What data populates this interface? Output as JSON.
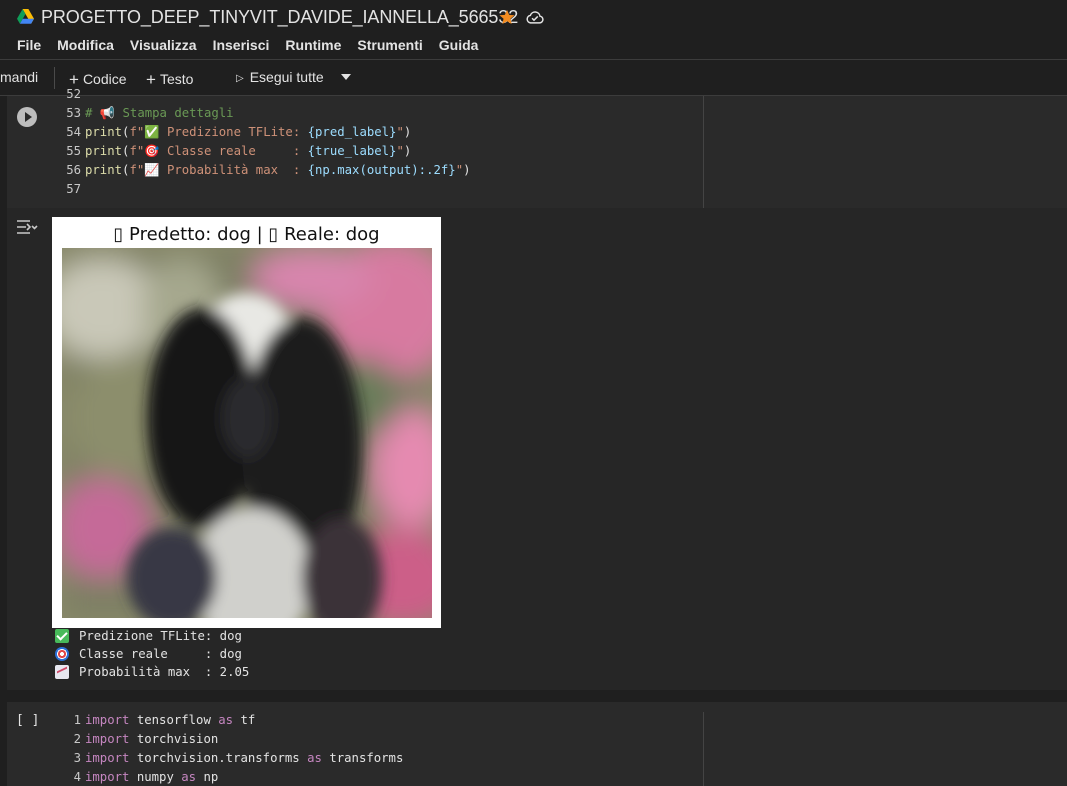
{
  "title": "PROGETTO_DEEP_TINYVIT_DAVIDE_IANNELLA_566532",
  "menu": [
    "File",
    "Modifica",
    "Visualizza",
    "Inserisci",
    "Runtime",
    "Strumenti",
    "Guida"
  ],
  "toolbar": {
    "clipped_label": "mandi",
    "add_code": "Codice",
    "add_text": "Testo",
    "run_all": "Esegui tutte"
  },
  "cell1": {
    "lines": [
      {
        "n": "52",
        "parts": []
      },
      {
        "n": "53",
        "parts": [
          {
            "t": "# 📢 Stampa dettagli",
            "c": "k-com"
          }
        ]
      },
      {
        "n": "54",
        "parts": [
          {
            "t": "print",
            "c": "k-fn"
          },
          {
            "t": "(",
            "c": "k-id"
          },
          {
            "t": "f\"✅ Predizione TFLite: ",
            "c": "k-str"
          },
          {
            "t": "{pred_label}",
            "c": "k-var"
          },
          {
            "t": "\"",
            "c": "k-str"
          },
          {
            "t": ")",
            "c": "k-id"
          }
        ]
      },
      {
        "n": "55",
        "parts": [
          {
            "t": "print",
            "c": "k-fn"
          },
          {
            "t": "(",
            "c": "k-id"
          },
          {
            "t": "f\"🎯 Classe reale     : ",
            "c": "k-str"
          },
          {
            "t": "{true_label}",
            "c": "k-var"
          },
          {
            "t": "\"",
            "c": "k-str"
          },
          {
            "t": ")",
            "c": "k-id"
          }
        ]
      },
      {
        "n": "56",
        "parts": [
          {
            "t": "print",
            "c": "k-fn"
          },
          {
            "t": "(",
            "c": "k-id"
          },
          {
            "t": "f\"📈 Probabilità max  : ",
            "c": "k-str"
          },
          {
            "t": "{np.max(output):.2f}",
            "c": "k-var"
          },
          {
            "t": "\"",
            "c": "k-str"
          },
          {
            "t": ")",
            "c": "k-id"
          }
        ]
      },
      {
        "n": "57",
        "parts": []
      }
    ]
  },
  "figure": {
    "title": "▯ Predetto: dog | ▯ Reale: dog"
  },
  "output": {
    "line1": "Predizione TFLite: dog",
    "line2": "Classe reale     : dog",
    "line3": "Probabilità max  : 2.05"
  },
  "cell2": {
    "bracket": "[ ]",
    "lines": [
      {
        "n": "1",
        "parts": [
          {
            "t": "import",
            "c": "k-kw"
          },
          {
            "t": " tensorflow ",
            "c": "k-id"
          },
          {
            "t": "as",
            "c": "k-kw"
          },
          {
            "t": " tf",
            "c": "k-id"
          }
        ]
      },
      {
        "n": "2",
        "parts": [
          {
            "t": "import",
            "c": "k-kw"
          },
          {
            "t": " torchvision",
            "c": "k-id"
          }
        ]
      },
      {
        "n": "3",
        "parts": [
          {
            "t": "import",
            "c": "k-kw"
          },
          {
            "t": " torchvision.transforms ",
            "c": "k-id"
          },
          {
            "t": "as",
            "c": "k-kw"
          },
          {
            "t": " transforms",
            "c": "k-id"
          }
        ]
      },
      {
        "n": "4",
        "parts": [
          {
            "t": "import",
            "c": "k-kw"
          },
          {
            "t": " numpy ",
            "c": "k-id"
          },
          {
            "t": "as",
            "c": "k-kw"
          },
          {
            "t": " np",
            "c": "k-id"
          }
        ]
      }
    ]
  }
}
